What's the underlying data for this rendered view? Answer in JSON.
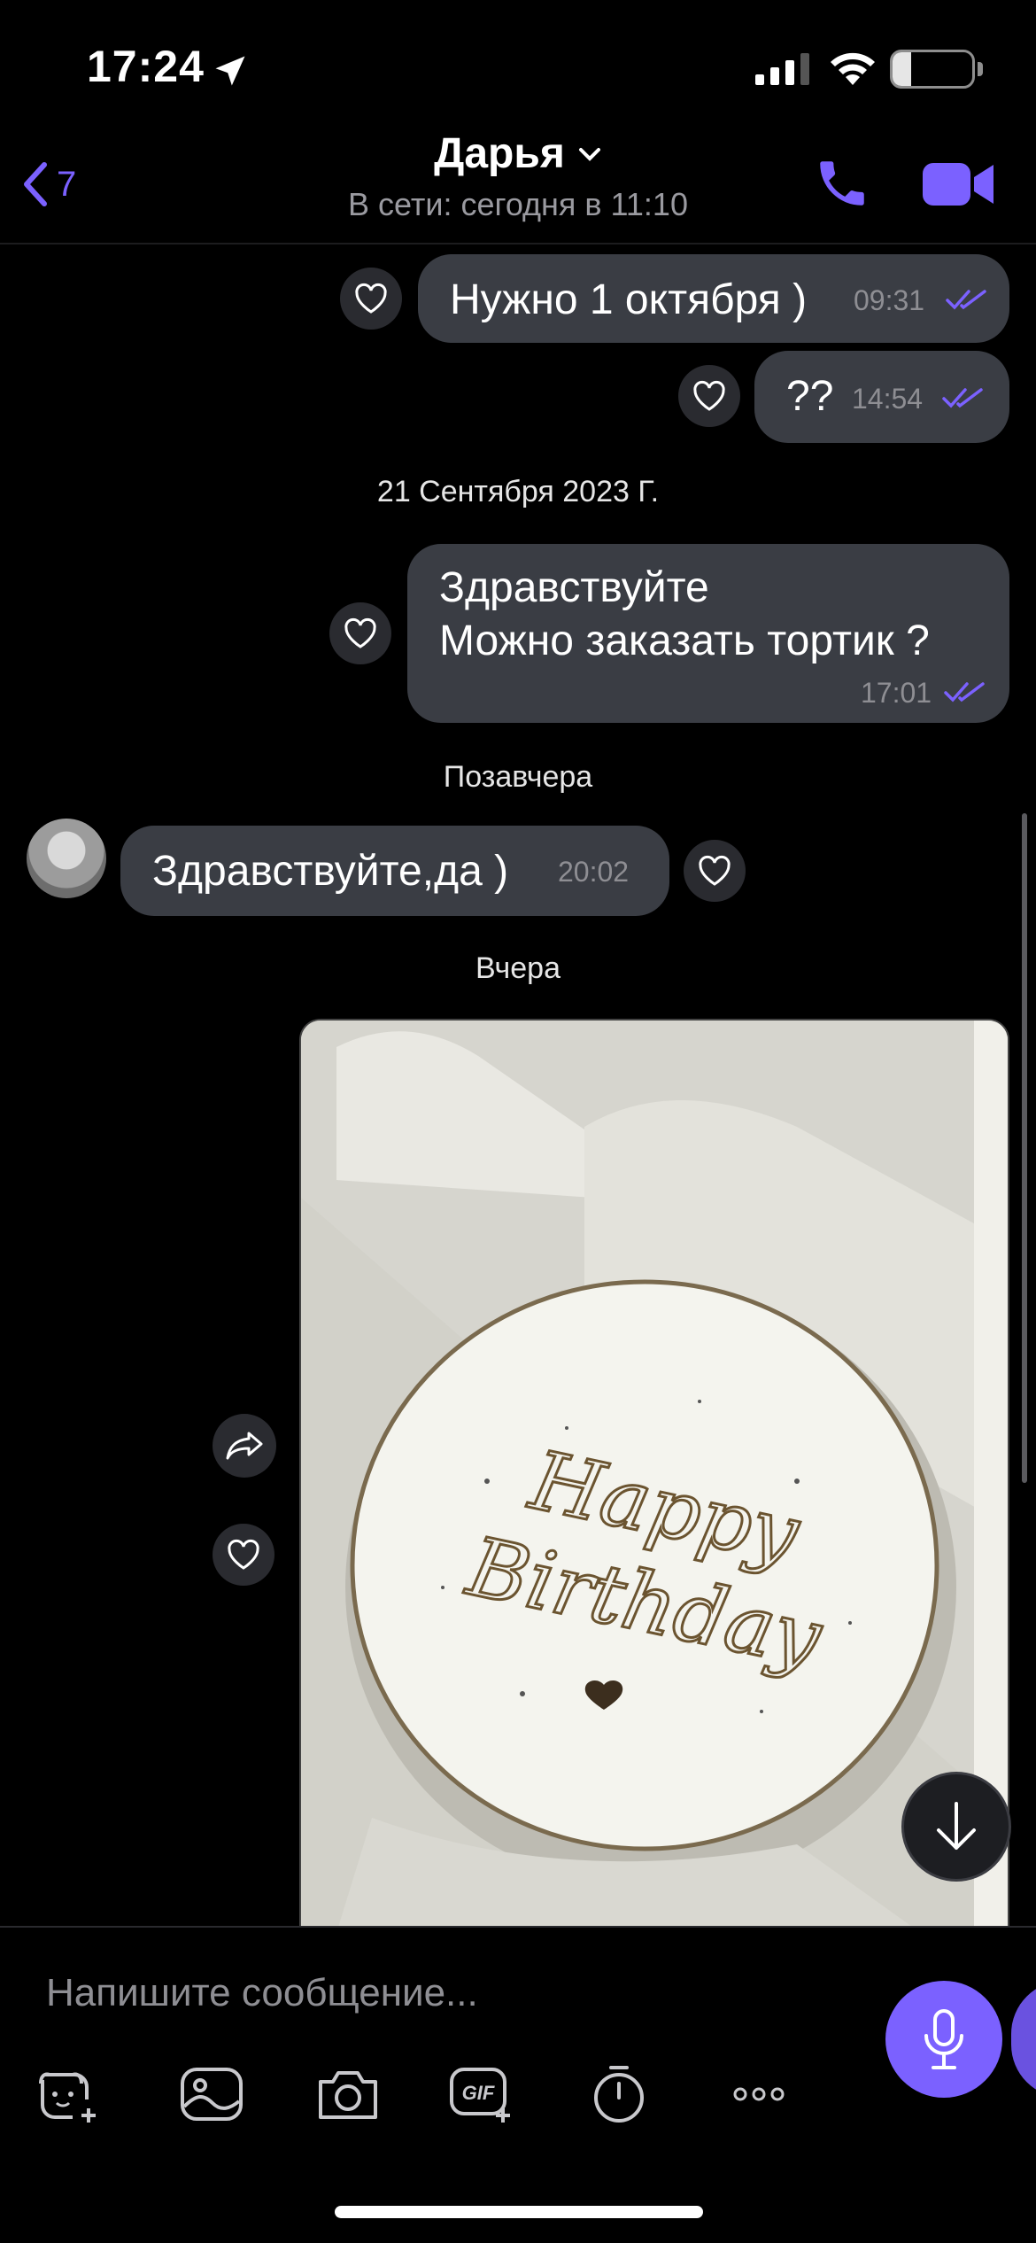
{
  "status_bar": {
    "time": "17:24",
    "battery": "23",
    "battery_level": 0.23,
    "icons": [
      "location-arrow-icon",
      "cellular-signal-icon",
      "wifi-icon",
      "battery-icon"
    ]
  },
  "header": {
    "back_count": "7",
    "contact_name": "Дарья",
    "contact_status": "В сети: сегодня в 11:10",
    "accent_color": "#7b61ff"
  },
  "messages": [
    {
      "text": "Нужно 1 октября )",
      "time": "09:31",
      "direction": "outgoing",
      "read": true
    },
    {
      "text": "??",
      "time": "14:54",
      "direction": "outgoing",
      "read": true
    },
    {
      "text_lines": [
        "Здравствуйте",
        "Можно заказать тортик ?"
      ],
      "time": "17:01",
      "direction": "outgoing",
      "read": true
    },
    {
      "text": "Здравствуйте,да )",
      "time": "20:02",
      "direction": "incoming"
    }
  ],
  "dates": {
    "d1": "21 Сентября 2023 Г.",
    "d2": "Позавчера",
    "d3": "Вчера"
  },
  "photo": {
    "inscription_line1": "Happy",
    "inscription_line2": "Birthday"
  },
  "composer": {
    "placeholder": "Напишите сообщение..."
  },
  "toolbar_icons": [
    "sticker-icon",
    "gallery-icon",
    "camera-icon",
    "gif-icon",
    "timer-icon",
    "more-icon"
  ]
}
